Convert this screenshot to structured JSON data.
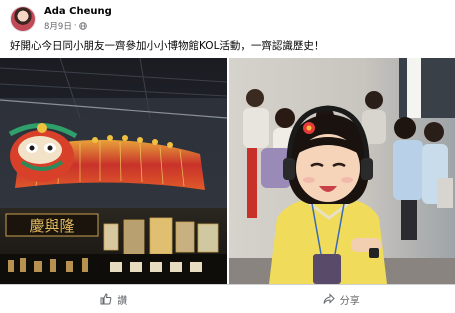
{
  "post": {
    "author": "Ada Cheung",
    "date": "8月9日",
    "separator": "·",
    "privacy_icon": "globe-icon",
    "text": "好開心今日同小朋友一齊參加小小博物館KOL活動，一齊認識歷史！"
  },
  "photos": {
    "left": {
      "sign_text": "慶與隆"
    },
    "right": {}
  },
  "actions": {
    "like_label": "讚",
    "share_label": "分享"
  },
  "colors": {
    "secondary_text": "#65676b",
    "divider": "#ced0d4"
  }
}
